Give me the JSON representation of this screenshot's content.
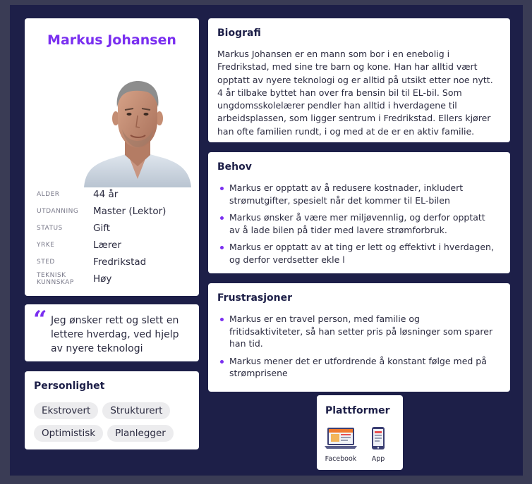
{
  "persona": {
    "name": "Markus Johansen",
    "attributes": [
      {
        "key": "ALDER",
        "value": "44 år"
      },
      {
        "key": "UTDANNING",
        "value": "Master (Lektor)"
      },
      {
        "key": "STATUS",
        "value": "Gift"
      },
      {
        "key": "YRKE",
        "value": "Lærer"
      },
      {
        "key": "STED",
        "value": "Fredrikstad"
      },
      {
        "key": "TEKNISK KUNNSKAP",
        "value": "Høy"
      }
    ]
  },
  "quote": {
    "text": "Jeg ønsker rett og slett en lettere hverdag, ved hjelp av nyere teknologi"
  },
  "personality": {
    "title": "Personlighet",
    "traits": [
      "Ekstrovert",
      "Strukturert",
      "Optimistisk",
      "Planlegger"
    ]
  },
  "biography": {
    "title": "Biografi",
    "text": "Markus Johansen er en mann som bor i en enebolig i Fredrikstad, med sine tre barn og kone. Han har alltid vært opptatt av nyere teknologi og er alltid på utsikt etter noe nytt. 4 år tilbake byttet han over fra bensin bil til EL-bil. Som ungdomsskolelærer pendler han alltid i hverdagene til arbeidsplassen, som ligger sentrum i Fredrikstad. Ellers kjører han ofte familien rundt, i og med at de er en aktiv familie."
  },
  "needs": {
    "title": "Behov",
    "items": [
      "Markus er opptatt av å redusere kostnader, inkludert strømutgifter, spesielt når det kommer til EL-bilen",
      "Markus ønsker å være mer miljøvennlig, og derfor opptatt av å lade bilen på tider med lavere strømforbruk.",
      "Markus er opptatt av at ting er lett og effektivt i hverdagen, og derfor verdsetter ekle l"
    ]
  },
  "frustrations": {
    "title": "Frustrasjoner",
    "items": [
      "Markus er en travel person, med familie og fritidsaktiviteter, så han setter pris på løsninger som sparer han tid.",
      "Markus mener det er utfordrende å konstant følge med på strømprisene"
    ]
  },
  "platforms": {
    "title": "Plattformer",
    "items": [
      {
        "label": "Facebook",
        "icon": "laptop-icon"
      },
      {
        "label": "App",
        "icon": "phone-icon"
      }
    ]
  },
  "colors": {
    "background": "#1d1f48",
    "accent": "#7a2ff0",
    "card": "#ffffff"
  }
}
